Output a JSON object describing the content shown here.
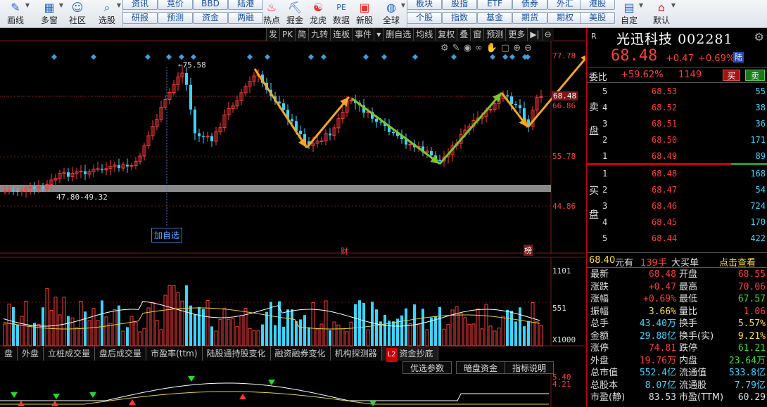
{
  "toolbar": {
    "left_buttons": [
      {
        "label": "画线",
        "icon": "pencil-icon"
      },
      {
        "label": "多窗",
        "icon": "multi-window-icon"
      },
      {
        "label": "社区",
        "icon": "community-icon"
      },
      {
        "label": "选股",
        "icon": "stock-picker-icon"
      }
    ],
    "pill_top": [
      "资讯",
      "竞价",
      "BBD",
      "陆港"
    ],
    "pill_bottom": [
      "研报",
      "预测",
      "资金",
      "两融"
    ],
    "mid_buttons": [
      {
        "label": "热点",
        "icon": "hotspot-icon"
      },
      {
        "label": "掘金",
        "icon": "gold-icon"
      },
      {
        "label": "龙虎",
        "icon": "dragon-tiger-icon"
      },
      {
        "label": "数据",
        "icon": "pe-data-icon"
      },
      {
        "label": "新股",
        "icon": "new-stock-icon"
      },
      {
        "label": "全球",
        "icon": "globe-icon"
      }
    ],
    "pill_top2": [
      "板块",
      "股指",
      "ETF",
      "债券",
      "外汇",
      "港股"
    ],
    "pill_bottom2": [
      "个股",
      "指数",
      "基金",
      "期货",
      "期权",
      "美股"
    ],
    "right_buttons": [
      {
        "label": "自定",
        "icon": "custom-icon"
      },
      {
        "label": "默认",
        "icon": "home-icon"
      }
    ]
  },
  "chart_toolbar": [
    "发",
    "PK",
    "简",
    "九转",
    "连板",
    "事件",
    "删自选",
    "均线",
    "复权",
    "叠",
    "窗",
    "预测",
    "更多"
  ],
  "price_axis": [
    "77.78",
    "66.86",
    "55.78",
    "44.86"
  ],
  "current_price_tag": "68.48",
  "high_annotation": "75.58",
  "range_annotation": "47.80-49.32",
  "add_watch_label": "加自选",
  "event_markers": [
    "财",
    "榜"
  ],
  "volume_axis": [
    "1101",
    "551",
    "X1000"
  ],
  "indicator_tabs": [
    "盘",
    "外盘",
    "立桩成交量",
    "盘后成交量",
    "市盈率(ttm)",
    "陆股通持股变化",
    "融资融券变化",
    "机构探测器",
    "资金抄底"
  ],
  "l2_badge": "L2",
  "sub_tabs": [
    "优选参数",
    "暗盘资金",
    "指标说明"
  ],
  "sub_axis": [
    "5.40",
    "4.21"
  ],
  "stock": {
    "badge": "R",
    "name": "光迅科技",
    "code": "002281",
    "price": "68.48",
    "change": "+0.47",
    "change_pct": "+0.69%",
    "market_badge": "陆",
    "weibi_label": "委比",
    "weibi_value": "+59.62%",
    "weicha_value": "1149",
    "buy_btn": "买",
    "sell_btn": "卖"
  },
  "ask_label": [
    "卖",
    "盘"
  ],
  "bid_label": [
    "买",
    "盘"
  ],
  "asks": [
    {
      "level": "5",
      "price": "68.53",
      "vol": "55"
    },
    {
      "level": "4",
      "price": "68.52",
      "vol": "38"
    },
    {
      "level": "3",
      "price": "68.51",
      "vol": "36"
    },
    {
      "level": "2",
      "price": "68.50",
      "vol": "171"
    },
    {
      "level": "1",
      "price": "68.49",
      "vol": "89"
    }
  ],
  "bids": [
    {
      "level": "1",
      "price": "68.48",
      "vol": "168"
    },
    {
      "level": "2",
      "price": "68.47",
      "vol": "54"
    },
    {
      "level": "3",
      "price": "68.46",
      "vol": "724"
    },
    {
      "level": "4",
      "price": "68.45",
      "vol": "170"
    },
    {
      "level": "5",
      "price": "68.44",
      "vol": "422"
    }
  ],
  "trade_line": {
    "price": "68.40",
    "unit1": "元有",
    "qty": "139手",
    "label": "大买单",
    "link": "点击查看"
  },
  "stats": [
    {
      "l1": "最新",
      "v1": "68.48",
      "c1": "#ff3b3b",
      "l2": "开盘",
      "v2": "68.55",
      "c2": "#ff3b3b"
    },
    {
      "l1": "涨跌",
      "v1": "+0.47",
      "c1": "#ff3b3b",
      "l2": "最高",
      "v2": "70.06",
      "c2": "#ff3b3b"
    },
    {
      "l1": "涨幅",
      "v1": "+0.69%",
      "c1": "#ff3b3b",
      "l2": "最低",
      "v2": "67.57",
      "c2": "#33dd33"
    },
    {
      "l1": "振幅",
      "v1": "3.66%",
      "c1": "#ffdf3a",
      "l2": "量比",
      "v2": "1.06",
      "c2": "#ff3b3b"
    },
    {
      "l1": "总手",
      "v1": "43.40万",
      "c1": "#3ad4ff",
      "l2": "换手",
      "v2": "5.57%",
      "c2": "#ffdf3a"
    },
    {
      "l1": "金额",
      "v1": "29.88亿",
      "c1": "#3ad4ff",
      "l2": "换手(实)",
      "v2": "9.21%",
      "c2": "#ffdf3a"
    },
    {
      "l1": "涨停",
      "v1": "74.81",
      "c1": "#ff3b3b",
      "l2": "跌停",
      "v2": "61.21",
      "c2": "#33dd33"
    },
    {
      "l1": "外盘",
      "v1": "19.76万",
      "c1": "#ff3b3b",
      "l2": "内盘",
      "v2": "23.64万",
      "c2": "#33dd33"
    },
    {
      "l1": "总市值",
      "v1": "552.4亿",
      "c1": "#3ad4ff",
      "l2": "流通值",
      "v2": "533.8亿",
      "c2": "#3ad4ff"
    },
    {
      "l1": "总股本",
      "v1": "8.07亿",
      "c1": "#3ad4ff",
      "l2": "流通股",
      "v2": "7.79亿",
      "c2": "#3ad4ff"
    },
    {
      "l1": "市盈(静)",
      "v1": "83.53",
      "c1": "#ddd",
      "l2": "市盈(TTM)",
      "v2": "60.29",
      "c2": "#ddd"
    }
  ],
  "colors": {
    "up": "#ff3b3b",
    "down": "#3ad4ff",
    "arrow_orange": "#f5a623",
    "arrow_green": "#7bc62d"
  }
}
